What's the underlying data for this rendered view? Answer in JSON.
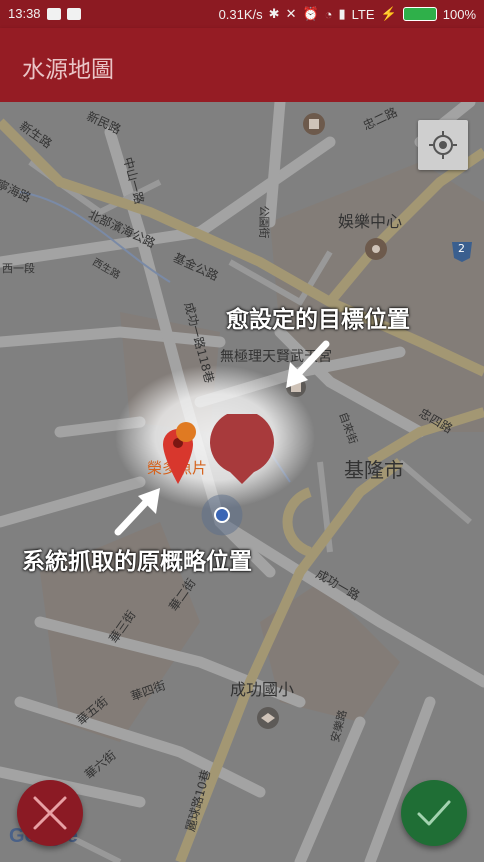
{
  "status_bar": {
    "time": "13:38",
    "speed": "0.31K/s",
    "network": "LTE",
    "battery": "100%"
  },
  "app_bar": {
    "title": "水源地圖"
  },
  "map": {
    "labels": {
      "xinsheng": "新生路",
      "xinmin": "新民路",
      "zhongshan": "中山一路",
      "ninghai": "寧海路",
      "xiyi": "西一段",
      "xisheng": "西生路",
      "beibu": "北部濱海公路",
      "jijin": "基金公路",
      "chenggong": "成功一路118巷",
      "chenggong2": "成功一路",
      "gongyuan": "公園街",
      "entertainment": "娛樂中心",
      "wuji": "無極理天賢武天宮",
      "zilai": "自來街",
      "keelung": "基隆市",
      "zhongsi": "忠四路",
      "zhonger": "忠二路",
      "fish": "榮多魚片",
      "huaer": "華二街",
      "huasan": "華三街",
      "huasi": "華四街",
      "huawu": "華五街",
      "hualiu": "華六街",
      "school": "成功國小",
      "ankang": "安樂路",
      "liqiu": "麗球路10巷",
      "shield": "2"
    },
    "annotation_target": "愈設定的目標位置",
    "annotation_origin": "系統抓取的原概略位置",
    "google": "Google",
    "icons": {
      "my_location": "crosshair-icon",
      "cancel": "close-icon",
      "confirm": "check-icon"
    }
  },
  "colors": {
    "primary": "#951c24",
    "status": "#8c1a22",
    "cancel": "#8b1a24",
    "confirm": "#1f6e35",
    "marker": "#a83a3c",
    "pin": "#d8372d"
  }
}
